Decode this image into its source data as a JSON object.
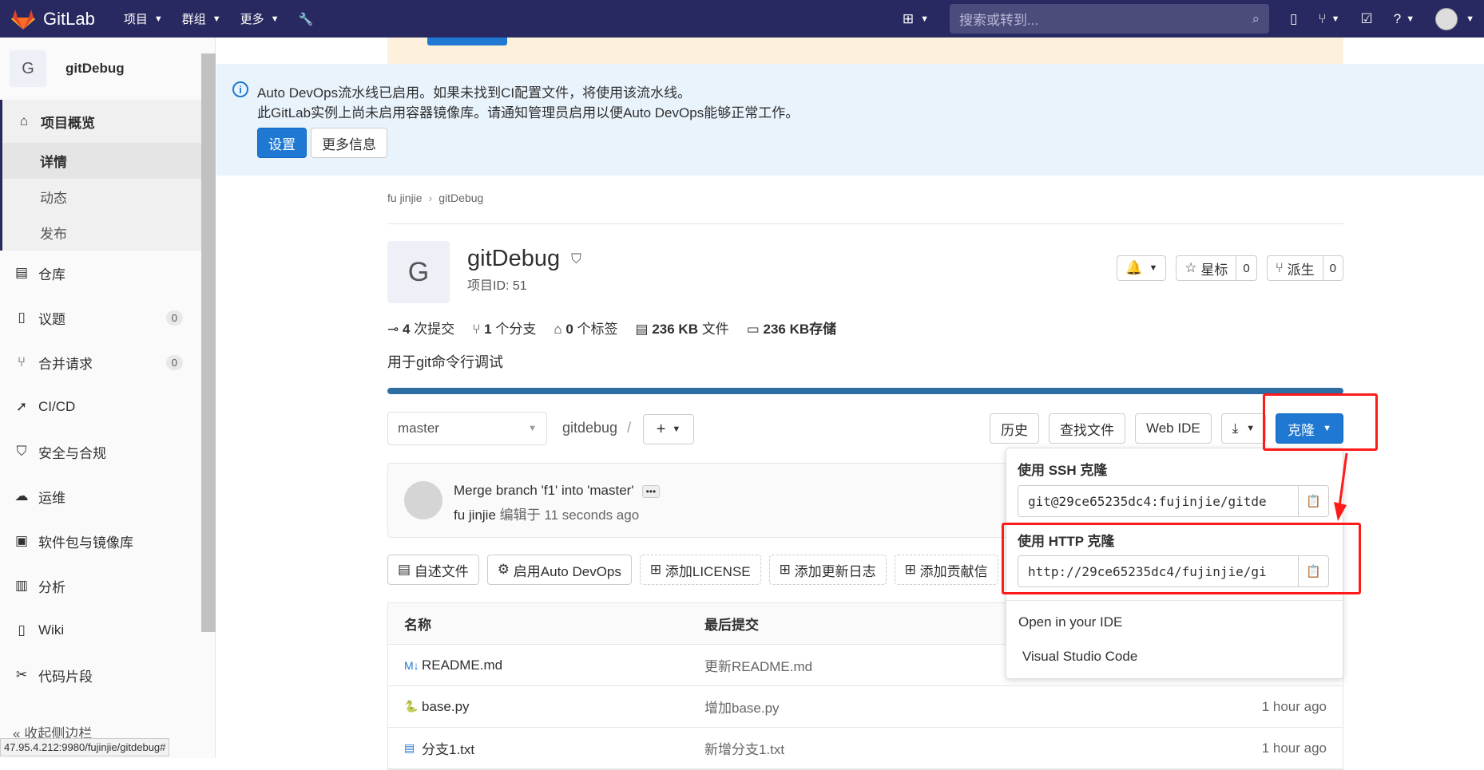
{
  "navbar": {
    "brand": "GitLab",
    "menu": [
      {
        "label": "项目"
      },
      {
        "label": "群组"
      },
      {
        "label": "更多"
      }
    ],
    "search_placeholder": "搜索或转到..."
  },
  "sidebar": {
    "project_letter": "G",
    "project_name": "gitDebug",
    "overview_label": "项目概览",
    "sub_items": [
      "详情",
      "动态",
      "发布"
    ],
    "items": [
      {
        "label": "仓库",
        "icon": "document-icon"
      },
      {
        "label": "议题",
        "icon": "issues-icon",
        "badge": "0"
      },
      {
        "label": "合并请求",
        "icon": "merge-request-icon",
        "badge": "0"
      },
      {
        "label": "CI/CD",
        "icon": "rocket-icon"
      },
      {
        "label": "安全与合规",
        "icon": "shield-icon"
      },
      {
        "label": "运维",
        "icon": "cloud-icon"
      },
      {
        "label": "软件包与镜像库",
        "icon": "package-icon"
      },
      {
        "label": "分析",
        "icon": "chart-icon"
      },
      {
        "label": "Wiki",
        "icon": "book-icon"
      },
      {
        "label": "代码片段",
        "icon": "scissors-icon"
      }
    ],
    "collapse_label": "收起侧边栏"
  },
  "status_url": "47.95.4.212:9980/fujinjie/gitdebug#",
  "devops_banner": {
    "line1": "Auto DevOps流水线已启用。如果未找到CI配置文件，将使用该流水线。",
    "line2": "此GitLab实例上尚未启用容器镜像库。请通知管理员启用以便Auto DevOps能够正常工作。",
    "settings_label": "设置",
    "more_label": "更多信息"
  },
  "breadcrumb": {
    "owner": "fu jinjie",
    "project": "gitDebug"
  },
  "project": {
    "letter": "G",
    "title": "gitDebug",
    "id_text": "项目ID: 51",
    "star_label": "星标",
    "star_count": "0",
    "fork_label": "派生",
    "fork_count": "0",
    "description": "用于git命令行调试"
  },
  "stats": {
    "commits_num": "4",
    "commits_label": "次提交",
    "branches_num": "1",
    "branches_label": "个分支",
    "tags_num": "0",
    "tags_label": "个标签",
    "files_num": "236 KB",
    "files_label": "文件",
    "storage_num": "236 KB",
    "storage_label": "存储"
  },
  "toolbar": {
    "branch": "master",
    "path": "gitdebug",
    "history_label": "历史",
    "find_label": "查找文件",
    "webide_label": "Web IDE",
    "clone_label": "克隆"
  },
  "commit": {
    "message": "Merge branch 'f1' into 'master'",
    "author": "fu jinjie",
    "edited": "编辑于 11 seconds ago"
  },
  "quick_actions": [
    "自述文件",
    "启用Auto DevOps",
    "添加LICENSE",
    "添加更新日志",
    "添加贡献信"
  ],
  "table": {
    "headers": [
      "名称",
      "最后提交"
    ],
    "rows": [
      {
        "name": "README.md",
        "commit": "更新README.md",
        "time": ""
      },
      {
        "name": "base.py",
        "commit": "增加base.py",
        "time": "1 hour ago"
      },
      {
        "name": "分支1.txt",
        "commit": "新增分支1.txt",
        "time": "1 hour ago"
      }
    ]
  },
  "clone_dropdown": {
    "ssh_label": "使用 SSH 克隆",
    "ssh_url": "git@29ce65235dc4:fujinjie/gitde",
    "http_label": "使用 HTTP 克隆",
    "http_url": "http://29ce65235dc4/fujinjie/gi",
    "ide_header": "Open in your IDE",
    "ide_option": "Visual Studio Code"
  },
  "colors": {
    "navbar": "#292961",
    "primary": "#1f78d1",
    "annotation": "#ff1a1a"
  }
}
